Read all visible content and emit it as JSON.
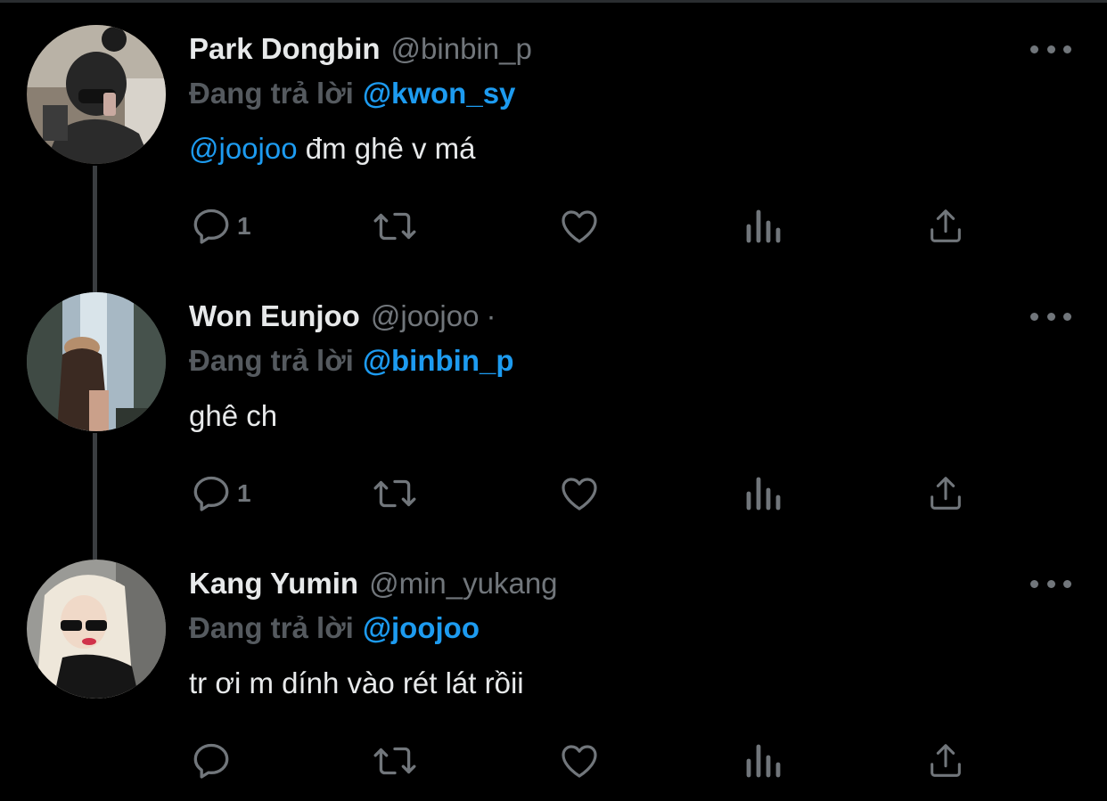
{
  "theme": {
    "background": "#000000",
    "text": "#e7e9ea",
    "secondary": "#71767b",
    "accent": "#1d9bf0",
    "connector": "#3a3d40"
  },
  "tweets": [
    {
      "display_name": "Park Dongbin",
      "handle": "@binbin_p",
      "separator": "",
      "reply_prefix": "Đang trả lời",
      "reply_to": "@kwon_sy",
      "body_mention": "@joojoo",
      "body_text": " đm ghê v má",
      "reply_count": "1",
      "avatar_icon": "avatar-photo"
    },
    {
      "display_name": "Won Eunjoo",
      "handle": "@joojoo",
      "separator": "·",
      "reply_prefix": "Đang trả lời",
      "reply_to": "@binbin_p",
      "body_mention": "",
      "body_text": "ghê ch",
      "reply_count": "1",
      "avatar_icon": "avatar-photo"
    },
    {
      "display_name": "Kang Yumin",
      "handle": "@min_yukang",
      "separator": "",
      "reply_prefix": "Đang trả lời",
      "reply_to": "@joojoo",
      "body_mention": "",
      "body_text": "tr ơi m dính vào rét lát rồii",
      "reply_count": "",
      "avatar_icon": "avatar-photo"
    }
  ],
  "icons": {
    "reply": "reply-icon",
    "retweet": "retweet-icon",
    "like": "heart-icon",
    "analytics": "analytics-icon",
    "share": "share-icon",
    "more": "more-icon"
  }
}
